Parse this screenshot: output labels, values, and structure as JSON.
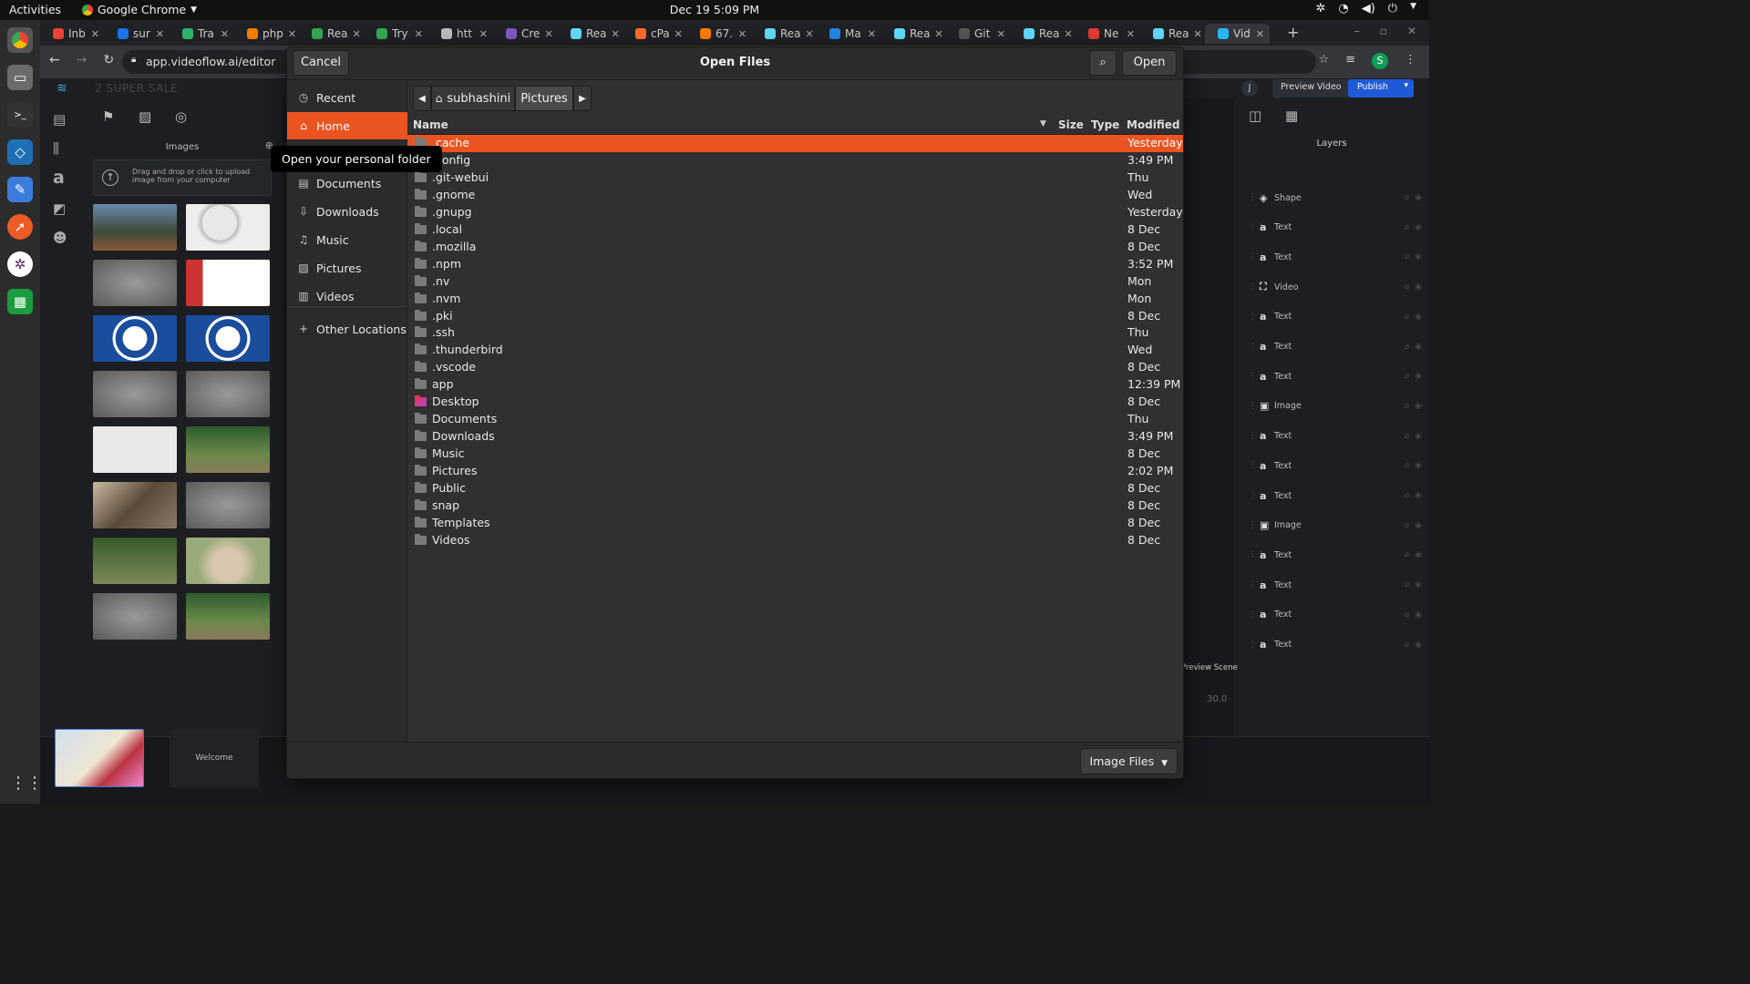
{
  "topbar": {
    "activities": "Activities",
    "app_name": "Google Chrome",
    "clock": "Dec 19  5:09 PM"
  },
  "browser": {
    "tabs": [
      {
        "label": "Inb",
        "color": "#ea4335"
      },
      {
        "label": "sur",
        "color": "#1a73e8"
      },
      {
        "label": "Tra",
        "color": "#2db36b"
      },
      {
        "label": "php",
        "color": "#f57c00"
      },
      {
        "label": "Rea",
        "color": "#34a853"
      },
      {
        "label": "Try",
        "color": "#34a853"
      },
      {
        "label": "htt",
        "color": "#bbbbbb"
      },
      {
        "label": "Cre",
        "color": "#7e57c2"
      },
      {
        "label": "Rea",
        "color": "#61dafb"
      },
      {
        "label": "cPa",
        "color": "#ff6c2c"
      },
      {
        "label": "67.",
        "color": "#f57c00"
      },
      {
        "label": "Rea",
        "color": "#61dafb"
      },
      {
        "label": "Ma",
        "color": "#1e88e5"
      },
      {
        "label": "Rea",
        "color": "#61dafb"
      },
      {
        "label": "Git",
        "color": "#555555"
      },
      {
        "label": "Rea",
        "color": "#61dafb"
      },
      {
        "label": "Ne",
        "color": "#e53935"
      },
      {
        "label": "Rea",
        "color": "#61dafb"
      },
      {
        "label": "Vid",
        "color": "#29b6f6"
      }
    ],
    "url": "app.videoflow.ai/editor",
    "profile_initial": "S"
  },
  "webapp": {
    "project_title": "2 SUPER SALE",
    "user_initial": "J",
    "preview_video": "Preview Video",
    "publish": "Publish",
    "images_label": "Images",
    "drop_text": "Drag and drop or click to upload image from your computer",
    "layers_title": "Layers",
    "layers": [
      "Shape",
      "Text",
      "Text",
      "Video",
      "Text",
      "Text",
      "Text",
      "Image",
      "Text",
      "Text",
      "Text",
      "Image",
      "Text",
      "Text",
      "Text",
      "Text"
    ],
    "scene2_label": "Welcome",
    "preview_scene": "Preview Scene",
    "duration": "30.0"
  },
  "dialog": {
    "title": "Open Files",
    "cancel": "Cancel",
    "open": "Open",
    "sidebar": [
      {
        "label": "Recent",
        "icon": "clock-icon"
      },
      {
        "label": "Home",
        "icon": "home-icon",
        "selected": true
      },
      {
        "label": "Documents",
        "icon": "document-icon"
      },
      {
        "label": "Downloads",
        "icon": "download-icon"
      },
      {
        "label": "Music",
        "icon": "music-icon"
      },
      {
        "label": "Pictures",
        "icon": "picture-icon"
      },
      {
        "label": "Videos",
        "icon": "video-icon"
      }
    ],
    "other_locations": "Other Locations",
    "path": [
      "subhashini",
      "Pictures"
    ],
    "columns": {
      "name": "Name",
      "size": "Size",
      "type": "Type",
      "modified": "Modified"
    },
    "files": [
      {
        "name": ".cache",
        "modified": "Yesterday",
        "selected": true
      },
      {
        "name": ".config",
        "modified": "3:49 PM"
      },
      {
        "name": ".git-webui",
        "modified": "Thu"
      },
      {
        "name": ".gnome",
        "modified": "Wed"
      },
      {
        "name": ".gnupg",
        "modified": "Yesterday"
      },
      {
        "name": ".local",
        "modified": "8 Dec"
      },
      {
        "name": ".mozilla",
        "modified": "8 Dec"
      },
      {
        "name": ".npm",
        "modified": "3:52 PM"
      },
      {
        "name": ".nv",
        "modified": "Mon"
      },
      {
        "name": ".nvm",
        "modified": "Mon"
      },
      {
        "name": ".pki",
        "modified": "8 Dec"
      },
      {
        "name": ".ssh",
        "modified": "Thu"
      },
      {
        "name": ".thunderbird",
        "modified": "Wed"
      },
      {
        "name": ".vscode",
        "modified": "8 Dec"
      },
      {
        "name": "app",
        "modified": "12:39 PM"
      },
      {
        "name": "Desktop",
        "modified": "8 Dec",
        "special": "desktop"
      },
      {
        "name": "Documents",
        "modified": "Thu"
      },
      {
        "name": "Downloads",
        "modified": "3:49 PM"
      },
      {
        "name": "Music",
        "modified": "8 Dec"
      },
      {
        "name": "Pictures",
        "modified": "2:02 PM"
      },
      {
        "name": "Public",
        "modified": "8 Dec"
      },
      {
        "name": "snap",
        "modified": "8 Dec"
      },
      {
        "name": "Templates",
        "modified": "8 Dec"
      },
      {
        "name": "Videos",
        "modified": "8 Dec"
      }
    ],
    "filter": "Image Files",
    "tooltip": "Open your personal folder"
  },
  "colors": {
    "accent": "#e95420",
    "publish": "#1f5bd8"
  }
}
